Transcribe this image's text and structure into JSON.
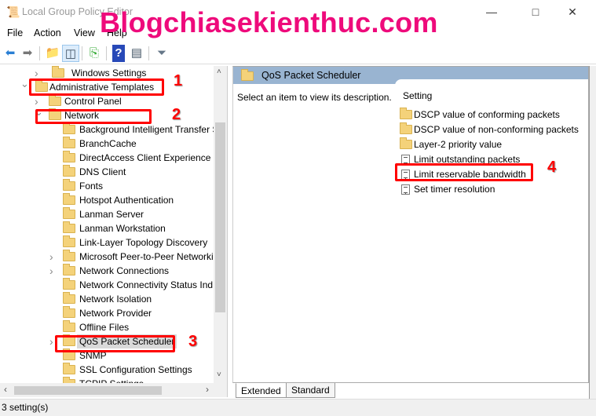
{
  "window": {
    "title": "Local Group Policy Editor",
    "watermark": "Blogchiasekienthuc.com"
  },
  "menu": [
    "File",
    "Action",
    "View",
    "Help"
  ],
  "toolbar": [
    "back-icon",
    "forward-icon",
    "up-folder-icon",
    "show-hide-tree-icon",
    "export-list-icon",
    "help-icon",
    "show-hide-action-pane-icon",
    "filter-icon"
  ],
  "tree": [
    {
      "label": "Windows Settings",
      "level": 0,
      "expander": "collapsed"
    },
    {
      "label": "Administrative Templates",
      "level": -1,
      "expander": "expanded"
    },
    {
      "label": "Control Panel",
      "level": 1,
      "expander": "collapsed"
    },
    {
      "label": "Network",
      "level": 1,
      "expander": "expanded"
    },
    {
      "label": "Background Intelligent Transfer S",
      "level": 2
    },
    {
      "label": "BranchCache",
      "level": 2
    },
    {
      "label": "DirectAccess Client Experience Se",
      "level": 2
    },
    {
      "label": "DNS Client",
      "level": 2
    },
    {
      "label": "Fonts",
      "level": 2
    },
    {
      "label": "Hotspot Authentication",
      "level": 2
    },
    {
      "label": "Lanman Server",
      "level": 2
    },
    {
      "label": "Lanman Workstation",
      "level": 2
    },
    {
      "label": "Link-Layer Topology Discovery",
      "level": 2
    },
    {
      "label": "Microsoft Peer-to-Peer Networki",
      "level": 2,
      "expander": "collapsed"
    },
    {
      "label": "Network Connections",
      "level": 2,
      "expander": "collapsed"
    },
    {
      "label": "Network Connectivity Status Ind",
      "level": 2
    },
    {
      "label": "Network Isolation",
      "level": 2
    },
    {
      "label": "Network Provider",
      "level": 2
    },
    {
      "label": "Offline Files",
      "level": 2
    },
    {
      "label": "QoS Packet Scheduler",
      "level": 2,
      "expander": "collapsed",
      "selected": true
    },
    {
      "label": "SNMP",
      "level": 2
    },
    {
      "label": "SSL Configuration Settings",
      "level": 2
    },
    {
      "label": "TCPIP Settings",
      "level": 2
    }
  ],
  "annotations": [
    "1",
    "2",
    "3",
    "4"
  ],
  "right": {
    "header": "QoS Packet Scheduler",
    "description": "Select an item to view its description.",
    "column": "Setting",
    "items": [
      {
        "label": "DSCP value of conforming packets",
        "type": "folder"
      },
      {
        "label": "DSCP value of non-conforming packets",
        "type": "folder"
      },
      {
        "label": "Layer-2 priority value",
        "type": "folder"
      },
      {
        "label": "Limit outstanding packets",
        "type": "setting"
      },
      {
        "label": "Limit reservable bandwidth",
        "type": "setting"
      },
      {
        "label": "Set timer resolution",
        "type": "setting"
      }
    ]
  },
  "tabs": [
    "Extended",
    "Standard"
  ],
  "status": "3 setting(s)",
  "colors": {
    "header": "#99b4d1",
    "annotation": "#ff0000",
    "watermark": "#ee0a7b"
  }
}
